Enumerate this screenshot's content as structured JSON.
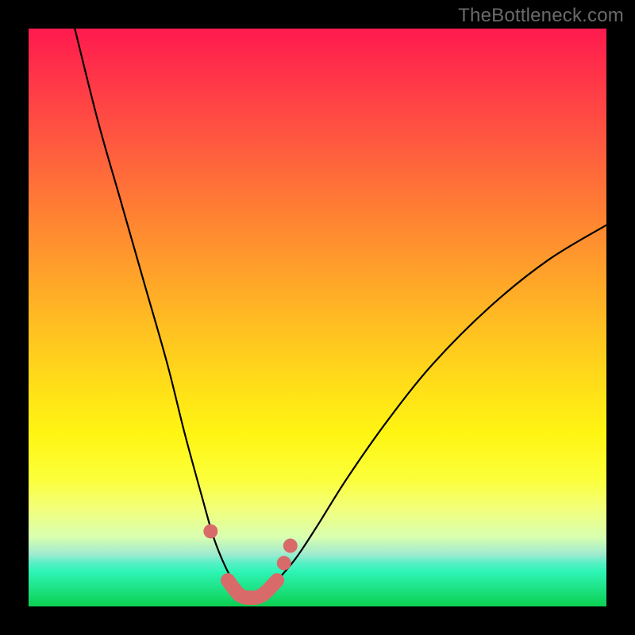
{
  "watermark": "TheBottleneck.com",
  "chart_data": {
    "type": "line",
    "title": "",
    "xlabel": "",
    "ylabel": "",
    "xlim": [
      0,
      100
    ],
    "ylim": [
      0,
      100
    ],
    "legend": false,
    "grid": false,
    "annotations": [],
    "curve": {
      "name": "bottleneck-curve",
      "x": [
        8,
        12,
        16,
        20,
        24,
        27,
        30,
        32,
        34,
        36,
        38,
        40,
        42,
        46,
        50,
        55,
        62,
        70,
        80,
        90,
        100
      ],
      "y": [
        100,
        84,
        70,
        56,
        42,
        30,
        19,
        12,
        7,
        3.5,
        2,
        2,
        3.5,
        8,
        14,
        22,
        32,
        42,
        52,
        60,
        66
      ]
    },
    "markers": {
      "name": "highlight-markers",
      "color": "#d96a6a",
      "points": [
        {
          "x": 31.5,
          "y": 13
        },
        {
          "x": 34.5,
          "y": 4.5
        },
        {
          "x": 36.5,
          "y": 2.0
        },
        {
          "x": 38.5,
          "y": 1.5
        },
        {
          "x": 40.5,
          "y": 2.0
        },
        {
          "x": 43.0,
          "y": 4.5
        },
        {
          "x": 44.2,
          "y": 7.5
        },
        {
          "x": 45.3,
          "y": 10.5
        }
      ]
    },
    "thick_segment": {
      "name": "valley-segment",
      "color": "#d96a6a",
      "x": [
        34.5,
        36.5,
        38.5,
        40.5,
        43.0
      ],
      "y": [
        4.5,
        2.0,
        1.5,
        2.0,
        4.5
      ]
    }
  }
}
